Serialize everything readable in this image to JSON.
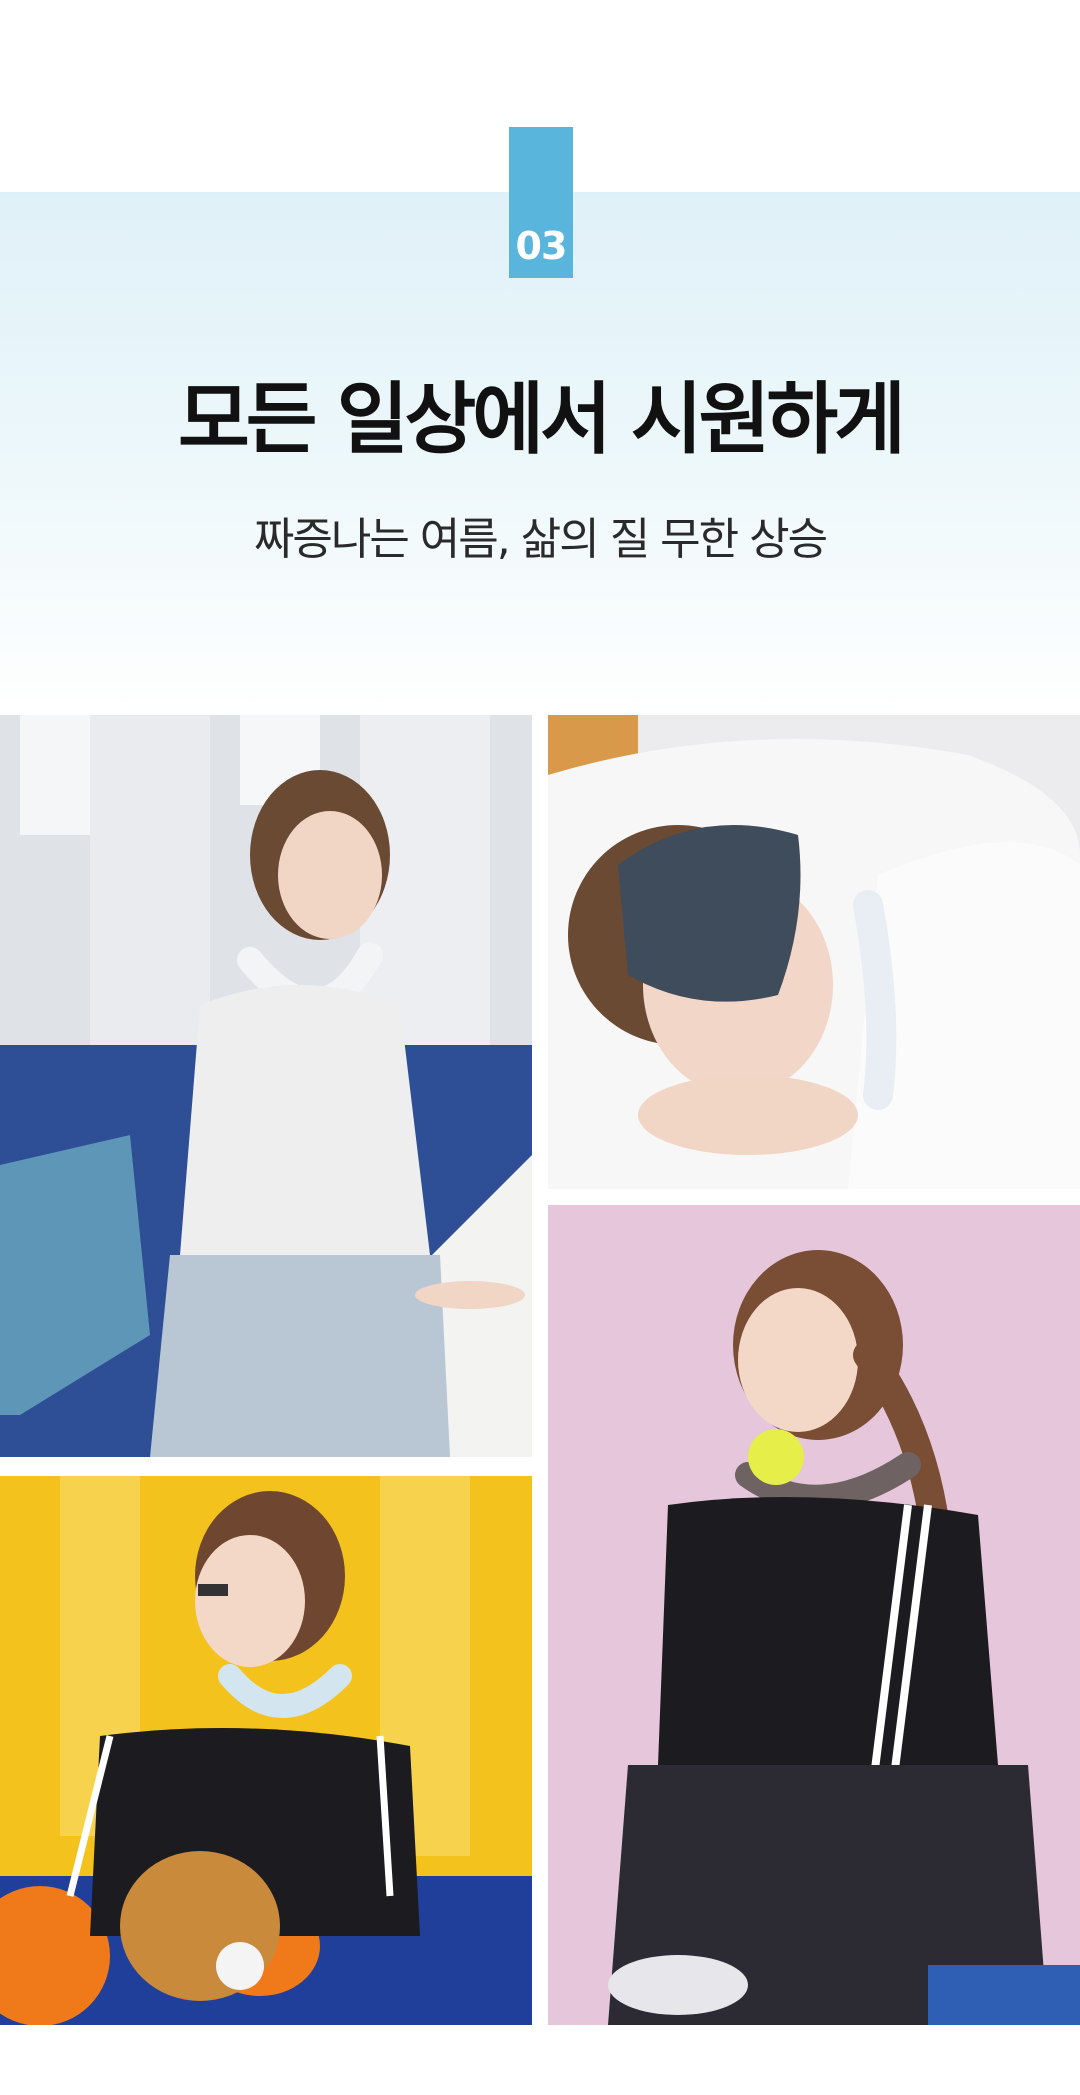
{
  "section": {
    "badge_number": "03",
    "title": "모든 일상에서 시원하게",
    "subtitle": "짜증나는 여름, 삶의 질 무한 상승"
  },
  "photos": [
    {
      "id": "office",
      "icon": "photo-woman-at-desk-wearing-neck-cooler"
    },
    {
      "id": "sleep",
      "icon": "photo-woman-sleeping-with-eye-mask-and-neck-cooler"
    },
    {
      "id": "pink",
      "icon": "photo-woman-holding-tennis-ball-with-neck-cooler"
    },
    {
      "id": "yellow",
      "icon": "photo-woman-with-baseball-glove-and-neck-cooler"
    }
  ],
  "colors": {
    "badge": "#5ab5dc",
    "hero_gradient_top": "#dff1f8",
    "title": "#111111"
  }
}
